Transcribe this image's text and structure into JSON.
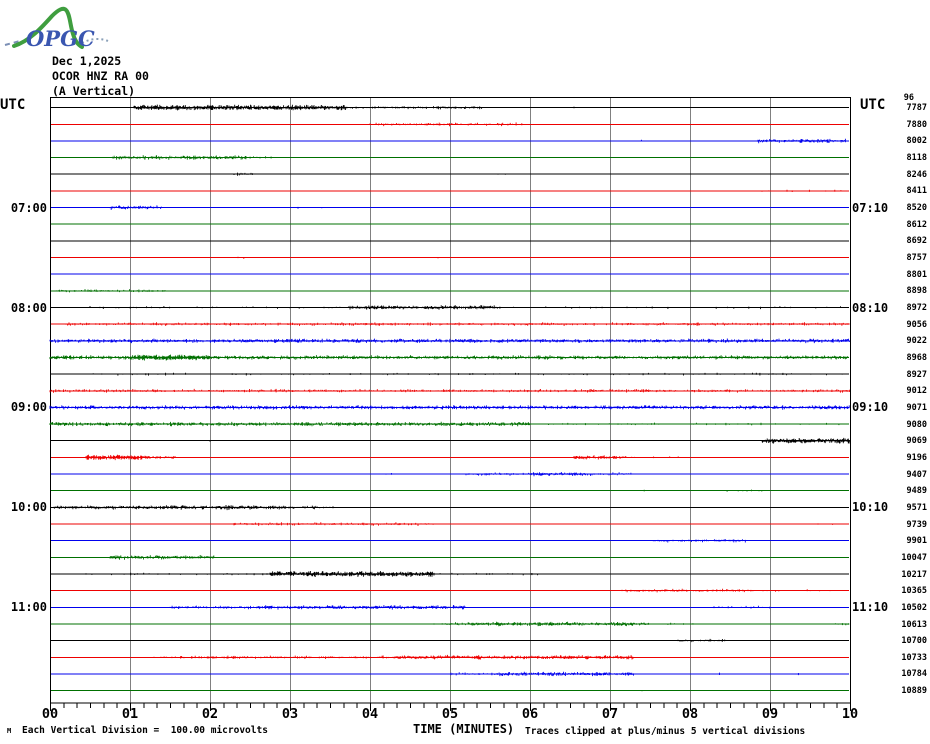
{
  "header": {
    "logo_text": "OPGC",
    "date": "Dec 1,2025",
    "station": "OCOR HNZ RA 00",
    "component": "(A Vertical)",
    "utc_left": "UTC",
    "utc_right": "UTC",
    "top_right_overlap_value": "96"
  },
  "footer": {
    "scale_note": "Each Vertical Division =  100.00 microvolts",
    "clip_note": "Traces clipped at plus/minus 5 vertical divisions",
    "micro_glyph": "M"
  },
  "x_axis": {
    "title": "TIME (MINUTES)",
    "tick_labels": [
      "00",
      "01",
      "02",
      "03",
      "04",
      "05",
      "06",
      "07",
      "08",
      "09",
      "10"
    ],
    "minutes_per_row": 10,
    "minor_ticks_per_major": 6
  },
  "chart_data": {
    "type": "line",
    "subtype": "helicorder-seismogram",
    "title": "OCOR HNZ RA 00 (A Vertical) Dec 1,2025",
    "xlabel": "TIME (MINUTES)",
    "x_range_minutes": [
      0,
      10
    ],
    "grid": "vertical-minute-lines",
    "grid_color": "#808080",
    "colors_cycle": [
      "#000000",
      "#ee0000",
      "#0000ee",
      "#007000"
    ],
    "hour_rows": [
      {
        "row": 7,
        "left": "07:00",
        "right": "07:10"
      },
      {
        "row": 13,
        "left": "08:00",
        "right": "08:10"
      },
      {
        "row": 19,
        "left": "09:00",
        "right": "09:10"
      },
      {
        "row": 25,
        "left": "10:00",
        "right": "10:10"
      },
      {
        "row": 31,
        "left": "11:00",
        "right": "11:10"
      }
    ],
    "traces": [
      {
        "row": 1,
        "value": "7787",
        "noise": [
          [
            1.05,
            3.7,
            4
          ],
          [
            3.7,
            5.4,
            2
          ],
          [
            6.55,
            6.65,
            1
          ]
        ]
      },
      {
        "row": 2,
        "value": "7880",
        "noise": [
          [
            4.0,
            5.9,
            2
          ]
        ]
      },
      {
        "row": 3,
        "value": "8002",
        "noise": [
          [
            7.3,
            7.4,
            1
          ],
          [
            8.85,
            9.95,
            3
          ]
        ]
      },
      {
        "row": 4,
        "value": "8118",
        "noise": [
          [
            0.78,
            2.45,
            3
          ],
          [
            2.45,
            2.9,
            1
          ]
        ]
      },
      {
        "row": 5,
        "value": "8246",
        "noise": [
          [
            2.3,
            2.55,
            2
          ],
          [
            5.6,
            5.75,
            1
          ]
        ]
      },
      {
        "row": 6,
        "value": "8411",
        "noise": [
          [
            8.9,
            9.9,
            1
          ]
        ]
      },
      {
        "row": 7,
        "value": "8520",
        "noise": [
          [
            0.75,
            1.4,
            3
          ],
          [
            3.1,
            3.4,
            1
          ]
        ]
      },
      {
        "row": 8,
        "value": "8612",
        "noise": []
      },
      {
        "row": 9,
        "value": "8692",
        "noise": []
      },
      {
        "row": 10,
        "value": "8757",
        "noise": [
          [
            2.35,
            2.45,
            1
          ],
          [
            4.85,
            4.95,
            1
          ]
        ]
      },
      {
        "row": 11,
        "value": "8801",
        "noise": []
      },
      {
        "row": 12,
        "value": "8898",
        "noise": [
          [
            0.05,
            1.5,
            2
          ]
        ]
      },
      {
        "row": 13,
        "value": "8972",
        "noise": [
          [
            0.5,
            10,
            1
          ],
          [
            3.75,
            5.6,
            3
          ]
        ]
      },
      {
        "row": 14,
        "value": "9056",
        "noise": [
          [
            0.2,
            10,
            2
          ]
        ]
      },
      {
        "row": 15,
        "value": "9022",
        "noise": [
          [
            0,
            10,
            3
          ]
        ]
      },
      {
        "row": 16,
        "value": "8968",
        "noise": [
          [
            0,
            10,
            3
          ],
          [
            1.0,
            2.0,
            4
          ]
        ]
      },
      {
        "row": 17,
        "value": "8927",
        "noise": [
          [
            0.5,
            10,
            1
          ]
        ]
      },
      {
        "row": 18,
        "value": "9012",
        "noise": [
          [
            0,
            10,
            2
          ]
        ]
      },
      {
        "row": 19,
        "value": "9071",
        "noise": [
          [
            0,
            10,
            3
          ]
        ]
      },
      {
        "row": 20,
        "value": "9080",
        "noise": [
          [
            0,
            6.0,
            3
          ],
          [
            6.0,
            10,
            1
          ]
        ]
      },
      {
        "row": 21,
        "value": "9069",
        "noise": [
          [
            2.0,
            2.1,
            1
          ],
          [
            8.9,
            10,
            4
          ]
        ]
      },
      {
        "row": 22,
        "value": "9196",
        "noise": [
          [
            0.45,
            1.25,
            4
          ],
          [
            1.25,
            1.6,
            2
          ],
          [
            6.55,
            7.2,
            3
          ],
          [
            7.2,
            8.0,
            1
          ]
        ]
      },
      {
        "row": 23,
        "value": "9407",
        "noise": [
          [
            4.2,
            4.9,
            1
          ],
          [
            5.2,
            7.3,
            2
          ],
          [
            6.0,
            6.7,
            3
          ]
        ]
      },
      {
        "row": 24,
        "value": "9489",
        "noise": [
          [
            7.3,
            7.5,
            1
          ],
          [
            8.4,
            8.9,
            1
          ]
        ]
      },
      {
        "row": 25,
        "value": "9571",
        "noise": [
          [
            0.05,
            3.05,
            3
          ],
          [
            3.05,
            3.55,
            2
          ],
          [
            2.2,
            2.3,
            4
          ]
        ]
      },
      {
        "row": 26,
        "value": "9739",
        "noise": [
          [
            2.3,
            4.8,
            2
          ],
          [
            9.6,
            9.8,
            1
          ]
        ]
      },
      {
        "row": 27,
        "value": "9901",
        "noise": [
          [
            7.5,
            8.7,
            2
          ]
        ]
      },
      {
        "row": 28,
        "value": "10047",
        "noise": [
          [
            0.75,
            2.05,
            3
          ]
        ]
      },
      {
        "row": 29,
        "value": "10217",
        "noise": [
          [
            0.3,
            2.75,
            1
          ],
          [
            2.75,
            4.8,
            4
          ],
          [
            4.8,
            6.2,
            1
          ]
        ]
      },
      {
        "row": 30,
        "value": "10365",
        "noise": [
          [
            0.8,
            0.9,
            1
          ],
          [
            7.15,
            8.8,
            2
          ],
          [
            8.8,
            9.9,
            1
          ]
        ]
      },
      {
        "row": 31,
        "value": "10502",
        "noise": [
          [
            1.5,
            2.6,
            2
          ],
          [
            2.6,
            5.2,
            3
          ],
          [
            8.3,
            9.0,
            1
          ]
        ]
      },
      {
        "row": 32,
        "value": "10613",
        "noise": [
          [
            4.8,
            5.2,
            2
          ],
          [
            5.2,
            7.5,
            3
          ],
          [
            7.5,
            8.1,
            1
          ],
          [
            9.8,
            10,
            2
          ]
        ]
      },
      {
        "row": 33,
        "value": "10700",
        "noise": [
          [
            0.8,
            0.9,
            1
          ],
          [
            7.85,
            8.45,
            2
          ]
        ]
      },
      {
        "row": 34,
        "value": "10733",
        "noise": [
          [
            1.3,
            4.3,
            2
          ],
          [
            4.3,
            7.3,
            3
          ]
        ]
      },
      {
        "row": 35,
        "value": "10784",
        "noise": [
          [
            5.0,
            5.6,
            2
          ],
          [
            5.6,
            7.3,
            3
          ],
          [
            8.3,
            8.5,
            1
          ],
          [
            9.3,
            9.4,
            1
          ]
        ]
      },
      {
        "row": 36,
        "value": "10889",
        "noise": [
          [
            7.4,
            7.45,
            1
          ]
        ]
      }
    ]
  }
}
